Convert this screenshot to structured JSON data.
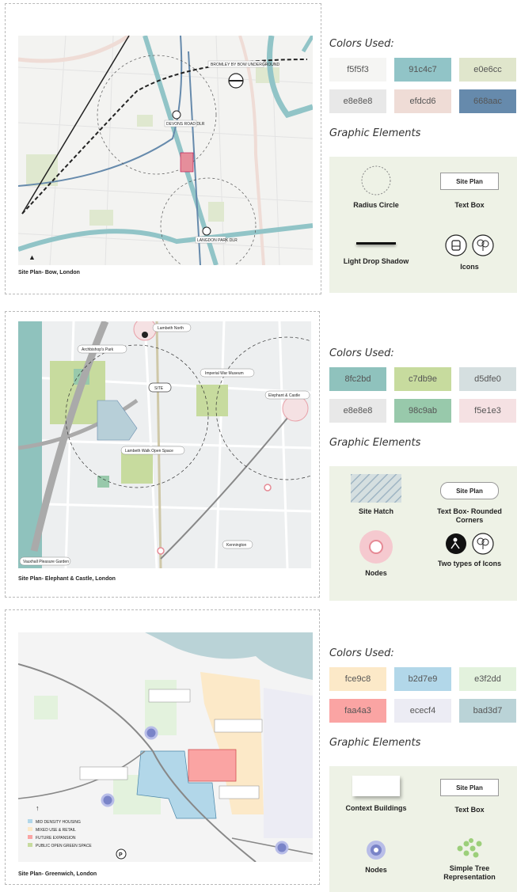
{
  "panels": [
    {
      "caption": "Site Plan- Bow, London",
      "map_labels": [
        "BROMLEY BY BOW UNDERGROUND",
        "DEVONS ROAD DLR",
        "LANGDON PARK DLR"
      ],
      "colors_heading": "Colors Used:",
      "colors": [
        {
          "hex": "#f5f5f3",
          "label": "f5f5f3"
        },
        {
          "hex": "#91c4c7",
          "label": "91c4c7"
        },
        {
          "hex": "#e0e6cc",
          "label": "e0e6cc"
        },
        {
          "hex": "#e8e8e8",
          "label": "e8e8e8"
        },
        {
          "hex": "#efdcd6",
          "label": "efdcd6"
        },
        {
          "hex": "#668aac",
          "label": "668aac"
        }
      ],
      "graphics_heading": "Graphic Elements",
      "elements": {
        "radius_circle": "Radius Circle",
        "text_box": "Text Box",
        "text_box_sample": "Site Plan",
        "drop_shadow": "Light Drop Shadow",
        "icons": "Icons"
      }
    },
    {
      "caption": "Site Plan- Elephant & Castle, London",
      "map_labels": [
        "Lambeth North",
        "Archbishop's Park",
        "SITE",
        "Imperial War Museum",
        "Elephant & Castle",
        "Lambeth Walk Open Space",
        "Kennington",
        "Vauxhall Pleasure Garden"
      ],
      "colors_heading": "Colors Used:",
      "colors": [
        {
          "hex": "#8fc2bd",
          "label": "8fc2bd"
        },
        {
          "hex": "#c7db9e",
          "label": "c7db9e"
        },
        {
          "hex": "#d5dfe0",
          "label": "d5dfe0"
        },
        {
          "hex": "#e8e8e8",
          "label": "e8e8e8"
        },
        {
          "hex": "#98c9ab",
          "label": "98c9ab"
        },
        {
          "hex": "#f5e1e3",
          "label": "f5e1e3"
        }
      ],
      "graphics_heading": "Graphic Elements",
      "elements": {
        "site_hatch": "Site Hatch",
        "text_box_rounded": "Text Box- Rounded Corners",
        "text_box_sample": "Site Plan",
        "nodes": "Nodes",
        "two_icons": "Two types of Icons"
      }
    },
    {
      "caption": "Site Plan- Greenwich, London",
      "legend": [
        "MID DENSITY HOUSING",
        "MIXED USE & RETAIL",
        "FUTURE EXPANSION",
        "PUBLIC OPEN GREEN SPACE"
      ],
      "colors_heading": "Colors Used:",
      "colors": [
        {
          "hex": "#fce9c8",
          "label": "fce9c8"
        },
        {
          "hex": "#b2d7e9",
          "label": "b2d7e9"
        },
        {
          "hex": "#e3f2dd",
          "label": "e3f2dd"
        },
        {
          "hex": "#faa4a3",
          "label": "faa4a3"
        },
        {
          "hex": "#ececf4",
          "label": "ececf4"
        },
        {
          "hex": "#bad3d7",
          "label": "bad3d7"
        }
      ],
      "graphics_heading": "Graphic Elements",
      "elements": {
        "context_buildings": "Context Buildings",
        "text_box": "Text Box",
        "text_box_sample": "Site Plan",
        "nodes": "Nodes",
        "simple_tree": "Simple Tree Representation"
      }
    }
  ]
}
